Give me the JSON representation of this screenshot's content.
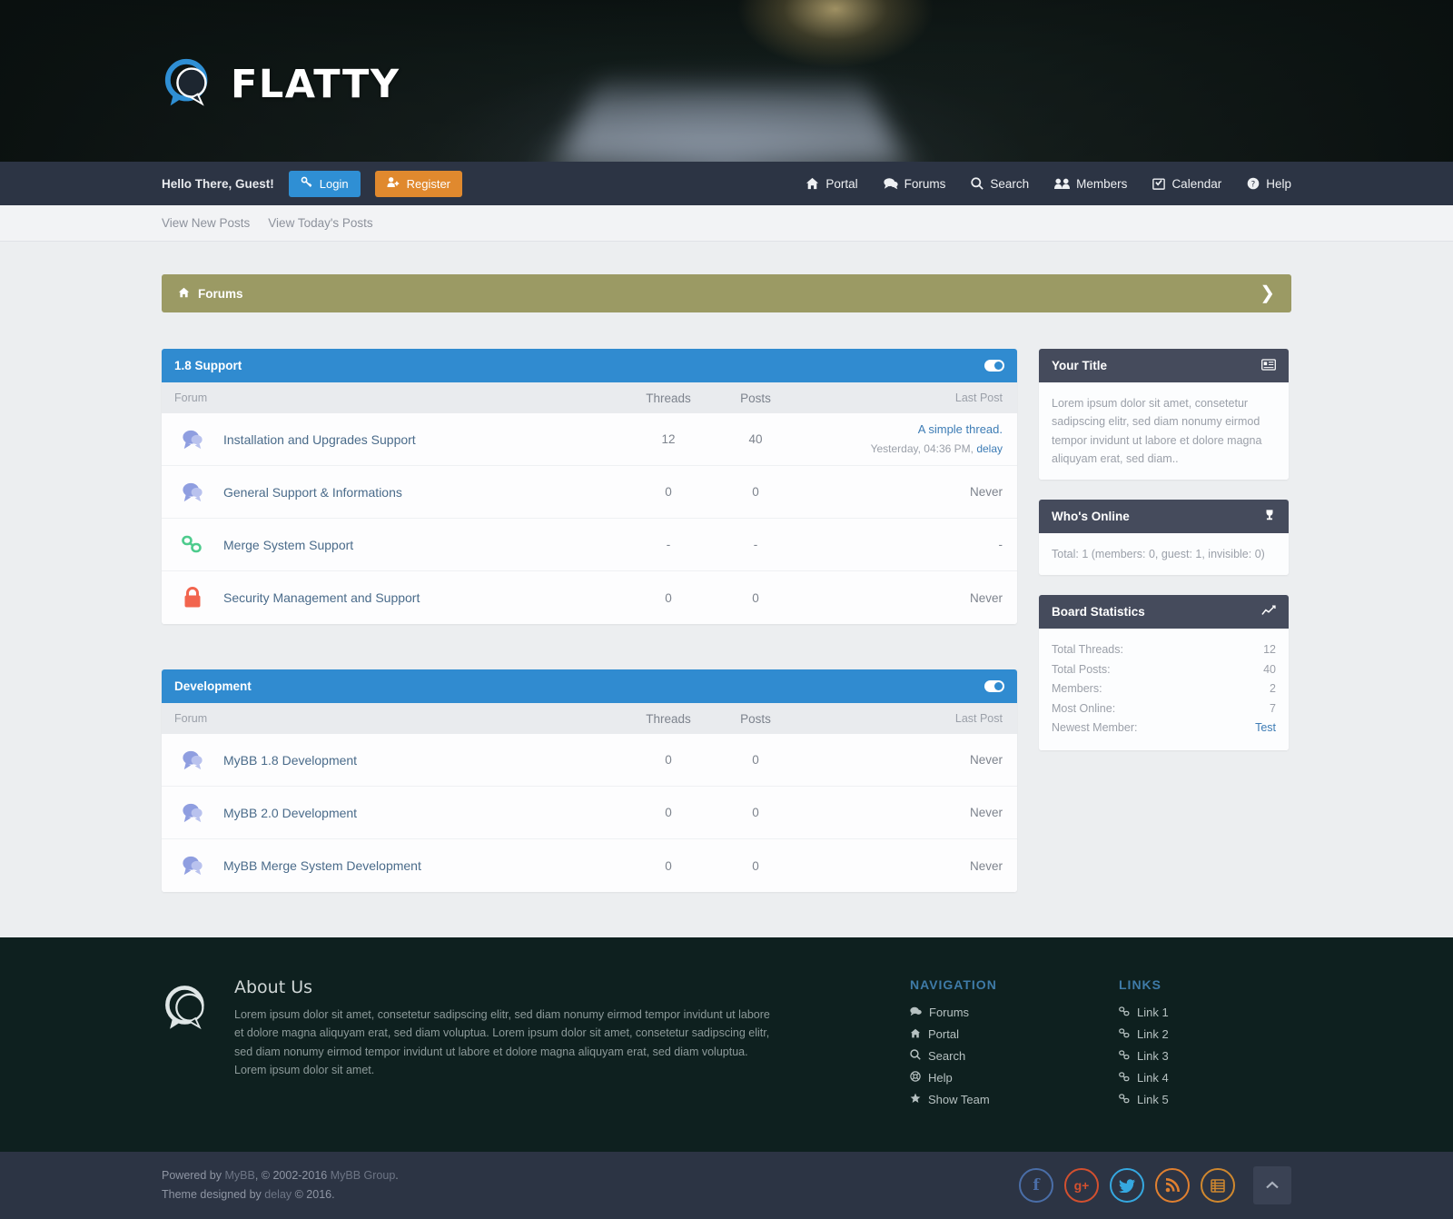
{
  "site": {
    "logo_text": "FLATTY",
    "logo_icon": "speech-bubbles-icon"
  },
  "topnav": {
    "greeting": "Hello There, Guest!",
    "login_label": "Login",
    "register_label": "Register",
    "items": [
      {
        "label": "Portal",
        "icon": "home-icon"
      },
      {
        "label": "Forums",
        "icon": "comments-icon"
      },
      {
        "label": "Search",
        "icon": "search-icon"
      },
      {
        "label": "Members",
        "icon": "users-icon"
      },
      {
        "label": "Calendar",
        "icon": "calendar-icon"
      },
      {
        "label": "Help",
        "icon": "question-circle-icon"
      }
    ]
  },
  "subnav": {
    "items": [
      {
        "label": "View New Posts"
      },
      {
        "label": "View Today's Posts"
      }
    ]
  },
  "breadcrumb": {
    "label": "Forums",
    "icon": "home-icon",
    "expand_icon": "chevron-right-icon",
    "color": "#9b9a64"
  },
  "table_headers": {
    "forum": "Forum",
    "threads": "Threads",
    "posts": "Posts",
    "last_post": "Last Post"
  },
  "categories": [
    {
      "title": "1.8 Support",
      "color": "#308bd0",
      "forums": [
        {
          "name": "Installation and Upgrades Support",
          "icon": "forum-bubble-icon",
          "icon_color": "#8f9ee0",
          "threads": "12",
          "posts": "40",
          "last_post_title": "A simple thread.",
          "last_post_meta": "Yesterday, 04:36 PM, ",
          "last_post_author": "delay"
        },
        {
          "name": "General Support & Informations",
          "icon": "forum-bubble-icon",
          "icon_color": "#8f9ee0",
          "threads": "0",
          "posts": "0",
          "last_post_never": "Never"
        },
        {
          "name": "Merge System Support",
          "icon": "link-chain-icon",
          "icon_color": "#4ecb8d",
          "threads": "-",
          "posts": "-",
          "last_post_never": "-"
        },
        {
          "name": "Security Management and Support",
          "icon": "lock-icon",
          "icon_color": "#f2654e",
          "threads": "0",
          "posts": "0",
          "last_post_never": "Never"
        }
      ]
    },
    {
      "title": "Development",
      "color": "#308bd0",
      "forums": [
        {
          "name": "MyBB 1.8 Development",
          "icon": "forum-bubble-icon",
          "icon_color": "#8f9ee0",
          "threads": "0",
          "posts": "0",
          "last_post_never": "Never"
        },
        {
          "name": "MyBB 2.0 Development",
          "icon": "forum-bubble-icon",
          "icon_color": "#8f9ee0",
          "threads": "0",
          "posts": "0",
          "last_post_never": "Never"
        },
        {
          "name": "MyBB Merge System Development",
          "icon": "forum-bubble-icon",
          "icon_color": "#8f9ee0",
          "threads": "0",
          "posts": "0",
          "last_post_never": "Never"
        }
      ]
    }
  ],
  "sidebar": {
    "your_title": {
      "title": "Your Title",
      "icon": "id-card-icon",
      "body": "Lorem ipsum dolor sit amet, consetetur sadipscing elitr, sed diam nonumy eirmod tempor invidunt ut labore et dolore magna aliquyam erat, sed diam.."
    },
    "whos_online": {
      "title": "Who's Online",
      "icon": "trophy-icon",
      "body": "Total: 1 (members: 0, guest: 1, invisible: 0)"
    },
    "board_statistics": {
      "title": "Board Statistics",
      "icon": "chart-line-icon",
      "rows": [
        {
          "label": "Total Threads:",
          "value": "12",
          "link": false
        },
        {
          "label": "Total Posts:",
          "value": "40",
          "link": false
        },
        {
          "label": "Members:",
          "value": "2",
          "link": false
        },
        {
          "label": "Most Online:",
          "value": "7",
          "link": false
        },
        {
          "label": "Newest Member:",
          "value": "Test",
          "link": true
        }
      ]
    }
  },
  "footer": {
    "about": {
      "heading": "About Us",
      "text": "Lorem ipsum dolor sit amet, consetetur sadipscing elitr, sed diam nonumy eirmod tempor invidunt ut labore et dolore magna aliquyam erat, sed diam voluptua. Lorem ipsum dolor sit amet, consetetur sadipscing elitr, sed diam nonumy eirmod tempor invidunt ut labore et dolore magna aliquyam erat, sed diam voluptua. Lorem ipsum dolor sit amet.",
      "logo_icon": "speech-bubbles-icon"
    },
    "navigation": {
      "heading": "NAVIGATION",
      "items": [
        {
          "label": "Forums",
          "icon": "comments-icon"
        },
        {
          "label": "Portal",
          "icon": "home-icon"
        },
        {
          "label": "Search",
          "icon": "search-icon"
        },
        {
          "label": "Help",
          "icon": "lifebuoy-icon"
        },
        {
          "label": "Show Team",
          "icon": "star-icon"
        }
      ]
    },
    "links": {
      "heading": "LINKS",
      "items": [
        {
          "label": "Link 1",
          "icon": "link-icon"
        },
        {
          "label": "Link 2",
          "icon": "link-icon"
        },
        {
          "label": "Link 3",
          "icon": "link-icon"
        },
        {
          "label": "Link 4",
          "icon": "link-icon"
        },
        {
          "label": "Link 5",
          "icon": "link-icon"
        }
      ]
    },
    "copyright": {
      "line1_pre": "Powered by ",
      "line1_mybb": "MyBB",
      "line1_mid": ", © 2002-2016 ",
      "line1_group": "MyBB Group",
      "line1_end": ".",
      "line2_pre": "Theme designed by ",
      "line2_author": "delay",
      "line2_end": " © 2016."
    },
    "socials": [
      {
        "name": "facebook",
        "glyph": "f",
        "color": "#4a6ea8"
      },
      {
        "name": "google-plus",
        "glyph": "g+",
        "color": "#d3502f"
      },
      {
        "name": "twitter",
        "glyph": "t",
        "color": "#35a8e0"
      },
      {
        "name": "rss",
        "glyph": "r",
        "color": "#e08030"
      },
      {
        "name": "feed-list",
        "glyph": "l",
        "color": "#d0882e"
      }
    ],
    "go_top_icon": "chevron-up-icon"
  }
}
